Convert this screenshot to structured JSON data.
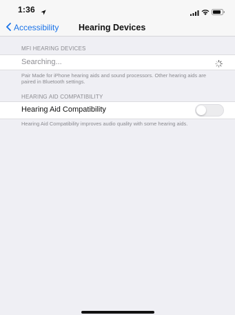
{
  "status_bar": {
    "time": "1:36",
    "location_icon": "location-arrow-icon",
    "signal_icon": "cellular-signal-icon",
    "wifi_icon": "wifi-icon",
    "battery_icon": "battery-icon"
  },
  "nav": {
    "back_label": "Accessibility",
    "title": "Hearing Devices"
  },
  "mfi_section": {
    "header": "MFI HEARING DEVICES",
    "status_text": "Searching...",
    "footer": "Pair Made for iPhone hearing aids and sound processors. Other hearing aids are paired in Bluetooth settings."
  },
  "hac_section": {
    "header": "HEARING AID COMPATIBILITY",
    "toggle_label": "Hearing Aid Compatibility",
    "toggle_on": false,
    "footer": "Hearing Aid Compatibility improves audio quality with some hearing aids."
  },
  "colors": {
    "accent": "#1a73e8",
    "background": "#efeff4"
  }
}
